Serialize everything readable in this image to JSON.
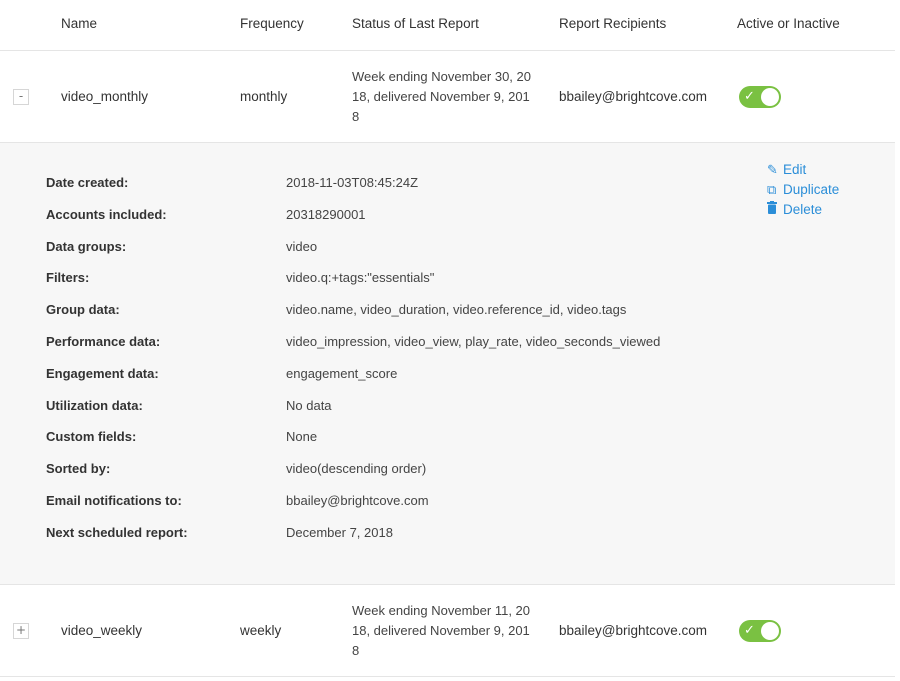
{
  "colors": {
    "toggle_on": "#7ac142",
    "link": "#2b8ed8"
  },
  "header": {
    "name": "Name",
    "frequency": "Frequency",
    "status": "Status of Last Report",
    "recipients": "Report Recipients",
    "active": "Active or Inactive"
  },
  "rows": [
    {
      "expander": "-",
      "name": "video_monthly",
      "frequency": "monthly",
      "status": "Week ending November 30, 2018, delivered November 9, 2018",
      "recipients": "bbailey@brightcove.com",
      "active": true,
      "toggle_icon": "check-icon"
    },
    {
      "expander": "+",
      "name": "video_weekly",
      "frequency": "weekly",
      "status": "Week ending November 11, 2018, delivered November 9, 2018",
      "recipients": "bbailey@brightcove.com",
      "active": true,
      "toggle_icon": "check-icon"
    }
  ],
  "details": [
    {
      "label": "Date created:",
      "value": "2018-11-03T08:45:24Z"
    },
    {
      "label": "Accounts included:",
      "value": "20318290001"
    },
    {
      "label": "Data groups:",
      "value": "video"
    },
    {
      "label": "Filters:",
      "value": "video.q:+tags:\"essentials\""
    },
    {
      "label": "Group data:",
      "value": "video.name, video_duration, video.reference_id, video.tags"
    },
    {
      "label": "Performance data:",
      "value": "video_impression, video_view, play_rate, video_seconds_viewed"
    },
    {
      "label": "Engagement data:",
      "value": "engagement_score"
    },
    {
      "label": "Utilization data:",
      "value": "No data"
    },
    {
      "label": "Custom fields:",
      "value": "None"
    },
    {
      "label": "Sorted by:",
      "value": "video(descending order)"
    },
    {
      "label": "Email notifications to:",
      "value": "bbailey@brightcove.com"
    },
    {
      "label": "Next scheduled report:",
      "value": "December 7, 2018"
    }
  ],
  "actions": {
    "edit": {
      "label": "Edit",
      "icon": "pencil-icon"
    },
    "duplicate": {
      "label": "Duplicate",
      "icon": "copy-icon"
    },
    "delete": {
      "label": "Delete",
      "icon": "trash-icon"
    }
  }
}
